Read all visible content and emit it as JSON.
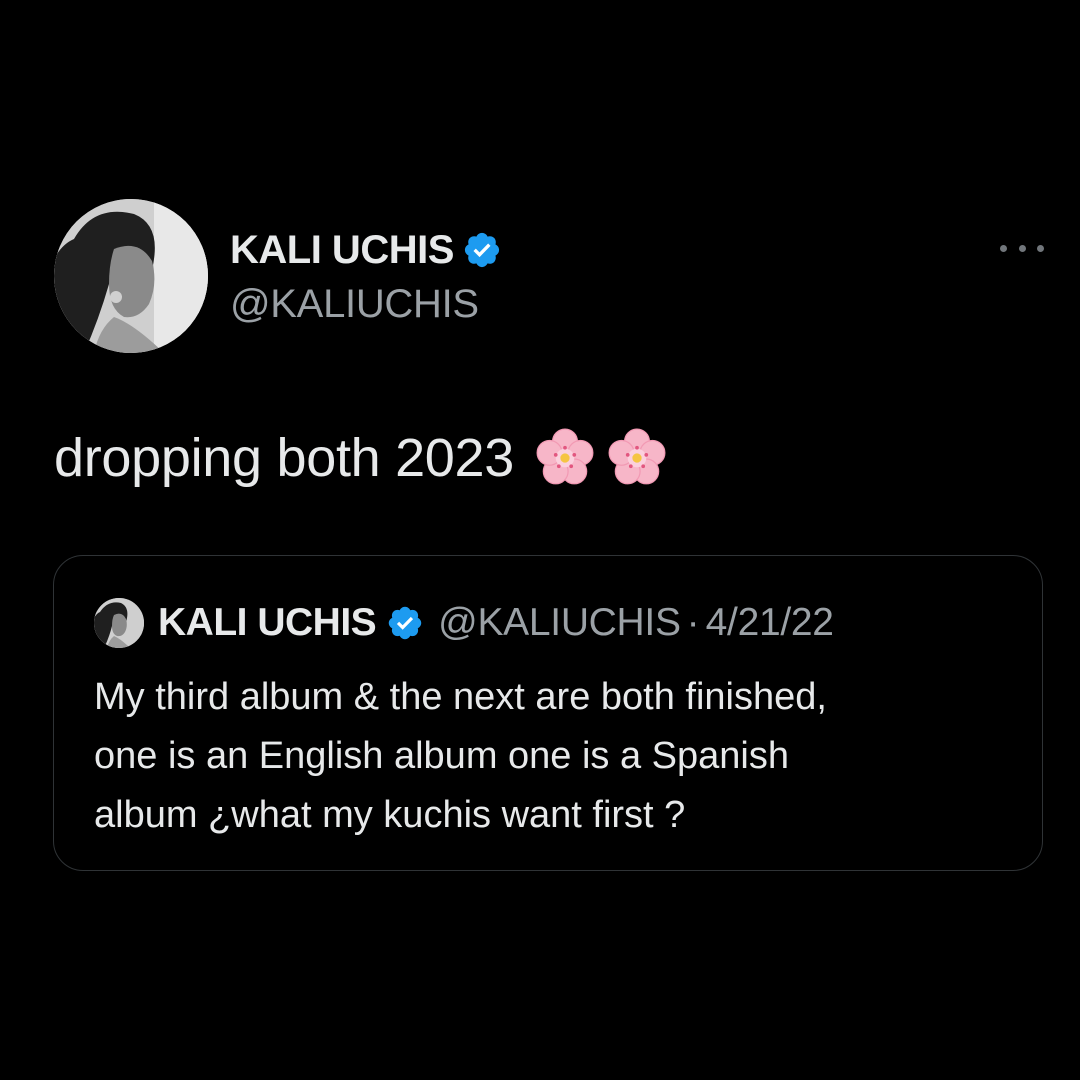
{
  "author": {
    "display_name": "KALI UCHIS",
    "handle": "@KALIUCHIS",
    "verified_icon": "verified-badge-icon",
    "avatar_icon": "profile-photo"
  },
  "menu": {
    "icon": "more-options-icon"
  },
  "tweet": {
    "text": "dropping both 2023",
    "emojis": [
      "cherry-blossom-icon",
      "cherry-blossom-icon"
    ]
  },
  "quoted_tweet": {
    "display_name": "KALI UCHIS",
    "handle": "@KALIUCHIS",
    "separator": "·",
    "date": "4/21/22",
    "lines": [
      "My third album & the next are both finished,",
      "one is an English album one is a Spanish",
      "album ¿what my kuchis want first ?"
    ]
  },
  "colors": {
    "background": "#000000",
    "primary_text": "#e7e9ea",
    "secondary_text": "#9ba1a6",
    "verified_blue": "#1d9bf0",
    "card_border": "#2f3336",
    "blossom_pink": "#f7b6c8"
  }
}
